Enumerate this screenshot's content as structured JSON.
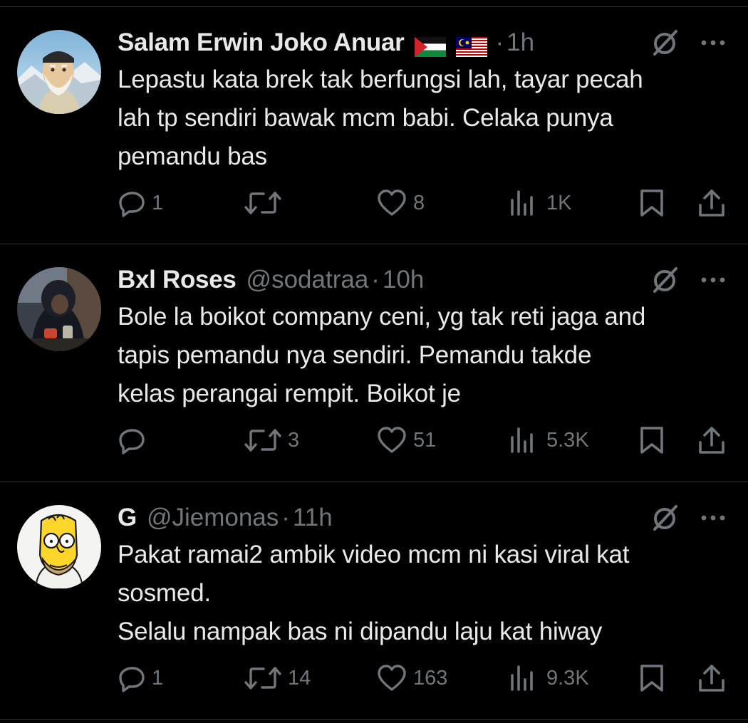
{
  "tweets": [
    {
      "name": "Salam Erwin Joko Anuar",
      "handle": "",
      "dot": "·",
      "time": "1h",
      "flags": [
        "palestine-flag",
        "malaysia-flag"
      ],
      "lines": [
        "Lepastu kata brek tak berfungsi lah, tayar pecah",
        "lah tp sendiri bawak mcm babi. Celaka punya",
        "pemandu bas"
      ],
      "stats": {
        "replies": "1",
        "reposts": "",
        "likes": "8",
        "views": "1K"
      }
    },
    {
      "name": "Bxl Roses",
      "handle": "@sodatraa",
      "dot": "·",
      "time": "10h",
      "lines": [
        "Bole la boikot company ceni, yg tak reti jaga and",
        "tapis pemandu nya sendiri. Pemandu takde",
        "kelas perangai rempit. Boikot je"
      ],
      "stats": {
        "replies": "",
        "reposts": "3",
        "likes": "51",
        "views": "5.3K"
      }
    },
    {
      "name": "G",
      "handle": "@Jiemonas",
      "dot": "·",
      "time": "11h",
      "lines": [
        "Pakat ramai2 ambik video mcm ni kasi viral kat",
        "sosmed.",
        "Selalu nampak bas ni dipandu laju kat hiway"
      ],
      "stats": {
        "replies": "1",
        "reposts": "14",
        "likes": "163",
        "views": "9.3K"
      }
    }
  ],
  "icons": {
    "grok": "grok-icon",
    "more": "more-icon",
    "reply": "reply-icon",
    "repost": "repost-icon",
    "like": "like-icon",
    "views": "views-icon",
    "bookmark": "bookmark-icon",
    "share": "share-icon"
  },
  "colors": {
    "background": "#000000",
    "text": "#e7e9ea",
    "secondary": "#71767b",
    "divider": "#2f3336"
  }
}
